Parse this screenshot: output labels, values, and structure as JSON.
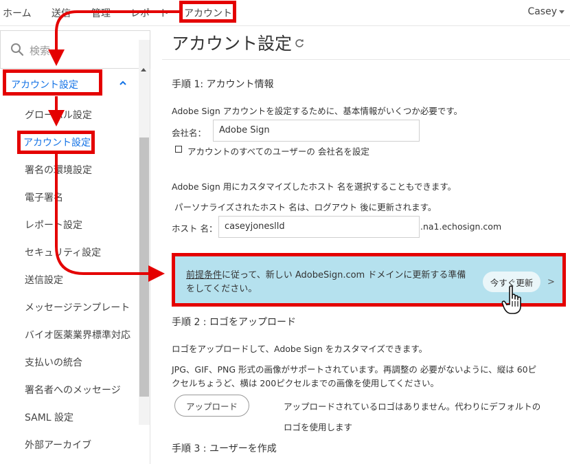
{
  "topnav": {
    "items": [
      "ホーム",
      "送信",
      "管理",
      "レポート",
      "アカウント"
    ],
    "user": "Casey"
  },
  "sidebar": {
    "search_placeholder": "検索",
    "section_label": "アカウント設定",
    "items": [
      "グローバル設定",
      "アカウント設定",
      "署名の環境設定",
      "電子署名",
      "レポート設定",
      "セキュリティ設定",
      "送信設定",
      "メッセージテンプレート",
      "バイオ医薬業界標準対応",
      "支払いの統合",
      "署名者へのメッセージ",
      "SAML 設定",
      "外部アーカイブ"
    ]
  },
  "main": {
    "title": "アカウント設定",
    "step1": {
      "title": "手順 1: アカウント情報",
      "desc": "Adobe Sign アカウントを設定するために、基本情報がいくつか必要です。",
      "company_label": "会社名：",
      "company_value": "Adobe Sign",
      "checkbox_label": "アカウントのすべてのユーザーの 会社名を設定",
      "host_desc1": "Adobe Sign 用にカスタマイズしたホスト 名を選択することもできます。",
      "host_desc2": "パーソナライズされたホスト 名は、ログアウト 後に更新されます。",
      "host_label": "ホスト 名：",
      "host_value": "caseyjoneslld",
      "host_suffix": ".na1.echosign.com"
    },
    "banner": {
      "link": "前提条件",
      "text1": "に従って、新しい AdobeSign.com ドメインに更新する準備",
      "text2": "をしてください。",
      "button": "今すぐ更新",
      "arrow": ">"
    },
    "step2": {
      "title": "手順 2 : ロゴをアップロード",
      "desc": "ロゴをアップロードして、Adobe Sign をカスタマイズできます。",
      "format1": "JPG、GIF、PNG 形式の画像がサポートされています。再調整の 必要がないように、縦は 60ピ",
      "format2": "クセルちょうど、横は 200ピクセルまでの画像を使用してください。",
      "upload_button": "アップロード",
      "nologo1": "アップロードされているロゴはありません。代わりにデフォルトの",
      "nologo2": "ロゴを使用します"
    },
    "step3": {
      "title": "手順 3 : ユーザーを作成"
    }
  },
  "colors": {
    "accent": "#1473e6",
    "highlight": "#e40000",
    "banner_bg": "#b5e1ee"
  }
}
